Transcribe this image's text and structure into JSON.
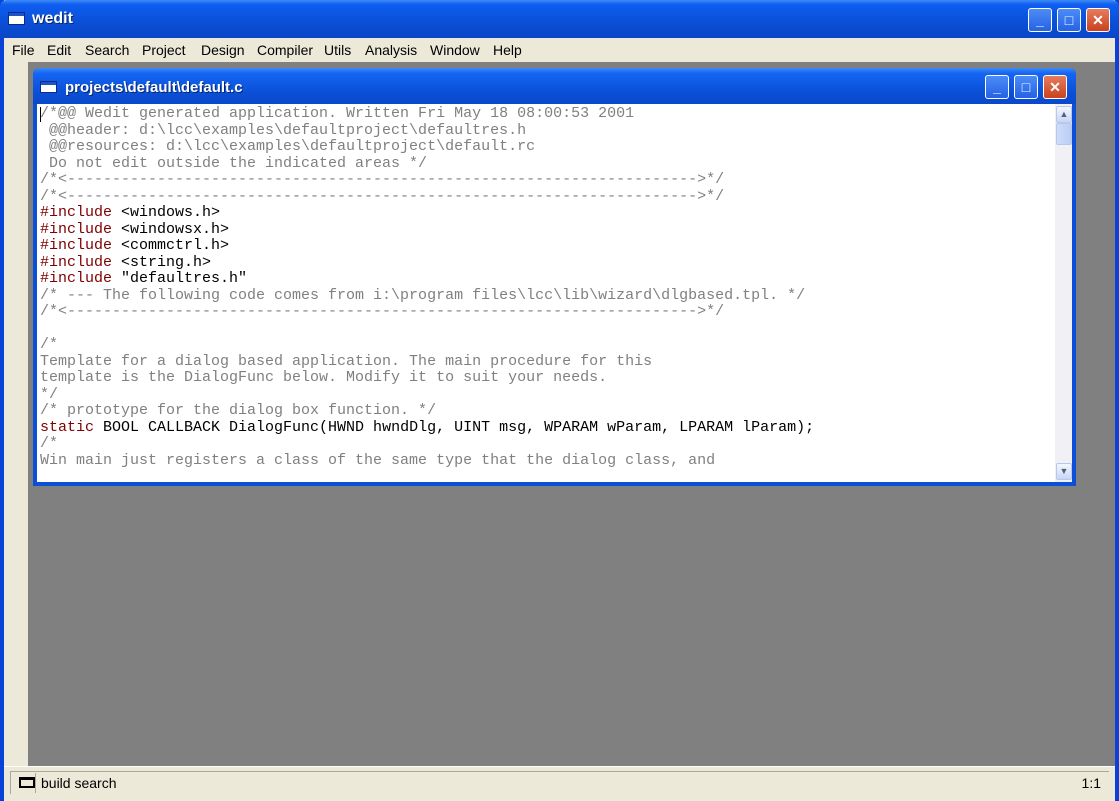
{
  "app": {
    "title": "wedit",
    "window_buttons": {
      "minimize": "_",
      "maximize": "□",
      "close": "✕"
    }
  },
  "menu": [
    "File",
    "Edit",
    "Search",
    "Project",
    "Design",
    "Compiler",
    "Utils",
    "Analysis",
    "Window",
    "Help"
  ],
  "editor_window": {
    "title": "projects\\default\\default.c",
    "scroll": {
      "up": "▲",
      "down": "▼"
    },
    "lines": [
      "/*@@ Wedit generated application. Written Fri May 18 08:00:53 2001",
      " @@header: d:\\lcc\\examples\\defaultproject\\defaultres.h",
      " @@resources: d:\\lcc\\examples\\defaultproject\\default.rc",
      " Do not edit outside the indicated areas */",
      "/*<---------------------------------------------------------------------->*/",
      "/*<---------------------------------------------------------------------->*/",
      "#include <windows.h>",
      "#include <windowsx.h>",
      "#include <commctrl.h>",
      "#include <string.h>",
      "#include \"defaultres.h\"",
      "/* --- The following code comes from i:\\program files\\lcc\\lib\\wizard\\dlgbased.tpl. */",
      "/*<---------------------------------------------------------------------->*/",
      "",
      "/*",
      "Template for a dialog based application. The main procedure for this",
      "template is the DialogFunc below. Modify it to suit your needs.",
      "*/",
      "/* prototype for the dialog box function. */",
      "static BOOL CALLBACK DialogFunc(HWND hwndDlg, UINT msg, WPARAM wParam, LPARAM lParam);",
      "/*",
      "Win main just registers a class of the same type that the dialog class, and"
    ]
  },
  "status": {
    "text": "build  search",
    "position": "1:1"
  }
}
